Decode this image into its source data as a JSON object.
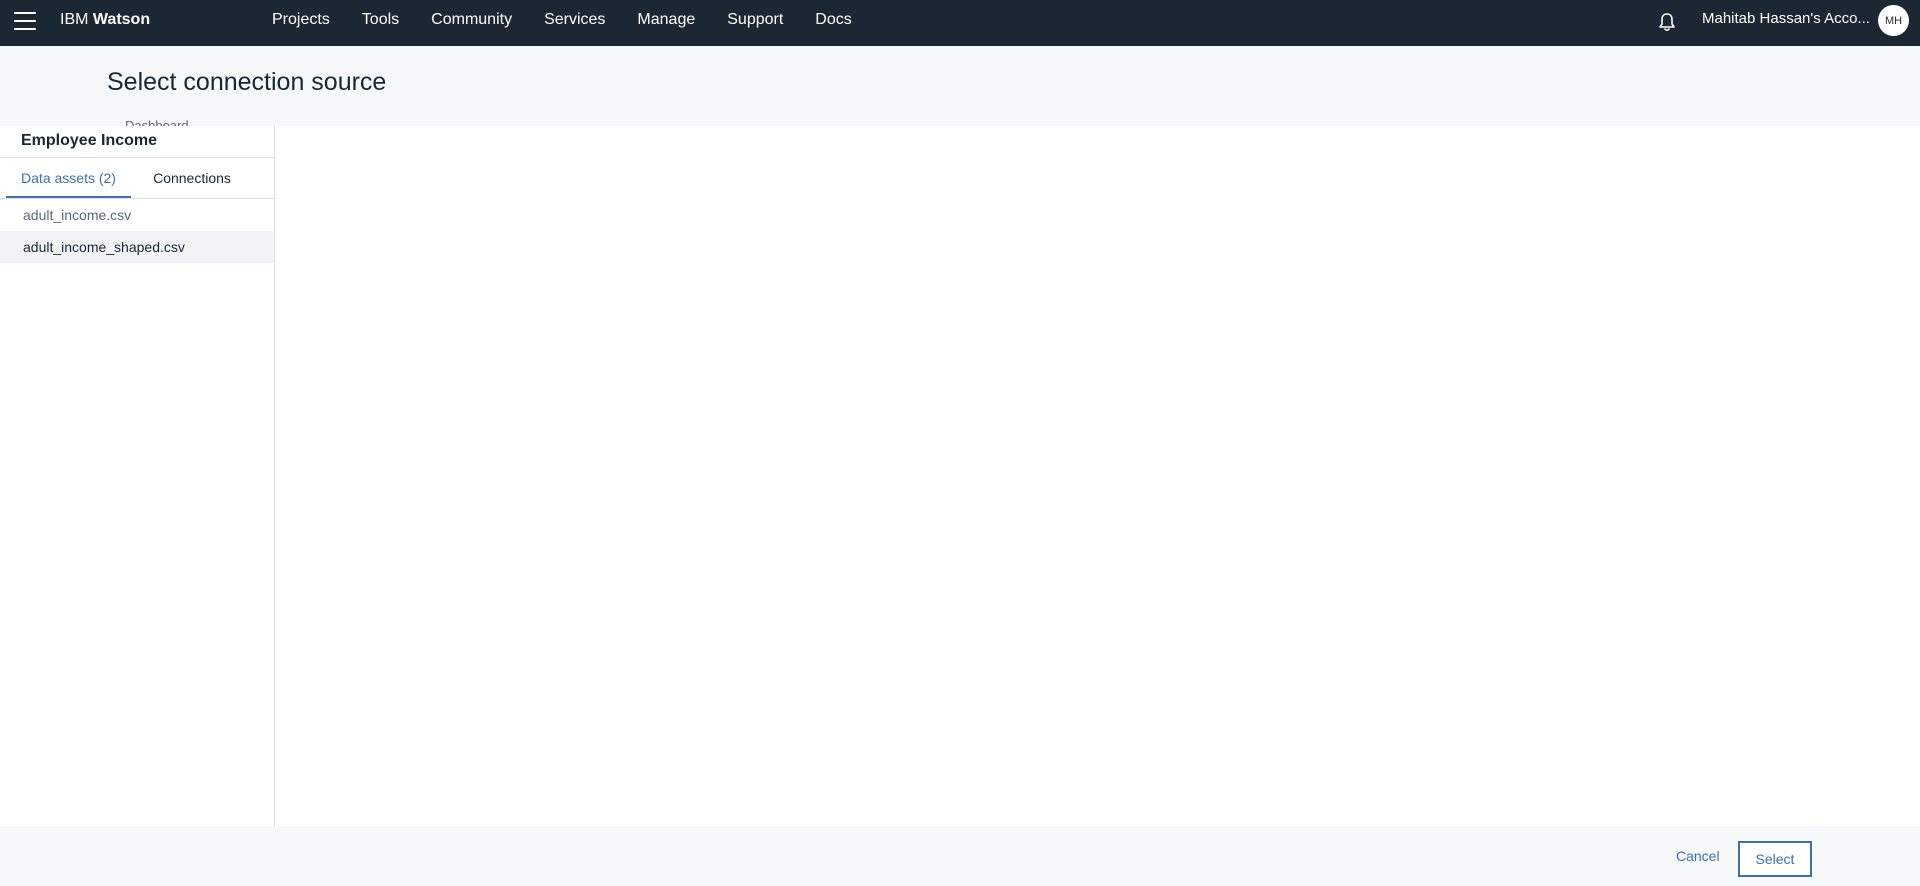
{
  "topbar": {
    "brand_prefix": "IBM",
    "brand_name": "Watson",
    "nav": [
      "Projects",
      "Tools",
      "Community",
      "Services",
      "Manage",
      "Support",
      "Docs"
    ],
    "account_label": "Mahitab Hassan's Acco...",
    "avatar_initials": "MH",
    "icons": [
      "menu-icon",
      "bell-icon"
    ]
  },
  "header": {
    "title": "Select connection source",
    "partially_hidden_text": "Dashboard"
  },
  "left_panel": {
    "project_name": "Employee Income",
    "tabs": [
      {
        "label": "Data assets (2)",
        "active": true
      },
      {
        "label": "Connections",
        "active": false
      }
    ],
    "assets": [
      {
        "label": "adult_income.csv",
        "selected": false
      },
      {
        "label": "adult_income_shaped.csv",
        "selected": true
      }
    ]
  },
  "footer": {
    "cancel_label": "Cancel",
    "select_label": "Select"
  },
  "colors": {
    "topbar_bg": "#1b2834",
    "accent": "#3d70b2",
    "header_bg": "#f7f8fa",
    "selected_row_bg": "#f2f3f5"
  }
}
